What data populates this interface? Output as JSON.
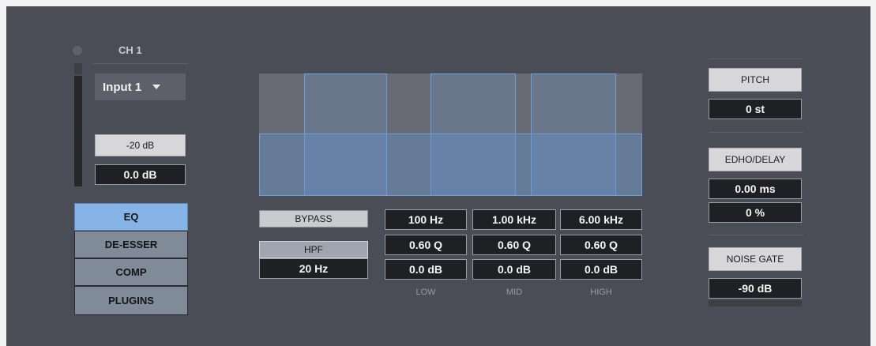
{
  "channel": {
    "title": "CH 1",
    "input_select": "Input 1",
    "trim_button": "-20 dB",
    "gain_value": "0.0 dB"
  },
  "tabs": [
    {
      "label": "EQ",
      "active": true
    },
    {
      "label": "DE-ESSER",
      "active": false
    },
    {
      "label": "COMP",
      "active": false
    },
    {
      "label": "PLUGINS",
      "active": false
    }
  ],
  "eq": {
    "bypass_label": "BYPASS",
    "hpf_label": "HPF",
    "hpf_value": "20 Hz",
    "bands": [
      {
        "name": "LOW",
        "freq": "100 Hz",
        "q": "0.60 Q",
        "gain": "0.0 dB"
      },
      {
        "name": "MID",
        "freq": "1.00 kHz",
        "q": "0.60 Q",
        "gain": "0.0 dB"
      },
      {
        "name": "HIGH",
        "freq": "6.00 kHz",
        "q": "0.60 Q",
        "gain": "0.0 dB"
      }
    ]
  },
  "pitch": {
    "label": "PITCH",
    "value": "0 st"
  },
  "delay": {
    "label": "EDHO/DELAY",
    "time": "0.00 ms",
    "mix": "0 %"
  },
  "gate": {
    "label": "NOISE GATE",
    "threshold": "-90 dB"
  },
  "colors": {
    "background": "#4a4d56",
    "accent_tab": "#86b4e6",
    "eq_band": "#6a9fdc",
    "value_box": "#1f2023"
  }
}
